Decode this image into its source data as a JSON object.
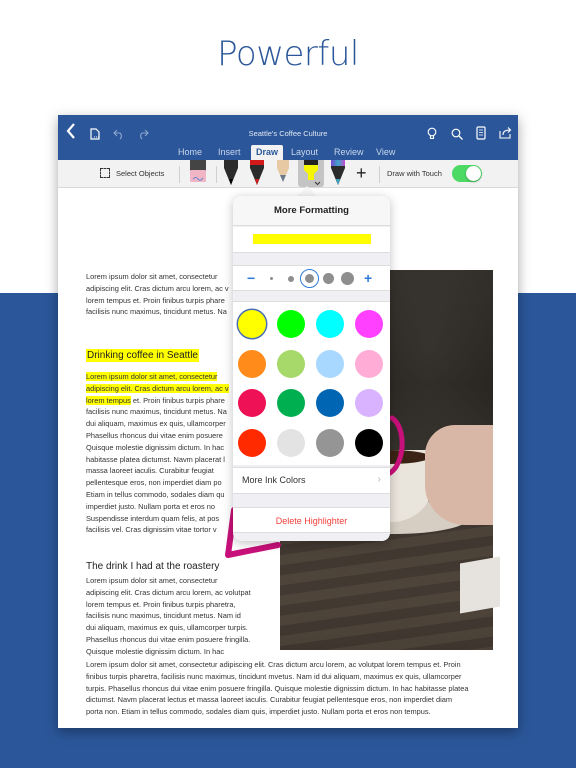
{
  "hero": {
    "title": "Powerful"
  },
  "app": {
    "doc_title": "Seattle's Coffee Culture",
    "tabs": [
      {
        "label": "Home",
        "active": false
      },
      {
        "label": "Insert",
        "active": false
      },
      {
        "label": "Draw",
        "active": true
      },
      {
        "label": "Layout",
        "active": false
      },
      {
        "label": "Review",
        "active": false
      },
      {
        "label": "View",
        "active": false
      }
    ],
    "titlebar_icons_left": [
      "back-icon",
      "file-icon",
      "undo-icon",
      "redo-icon"
    ],
    "titlebar_icons_right": [
      "lightbulb-icon",
      "search-icon",
      "device-view-icon",
      "share-icon"
    ]
  },
  "ribbon": {
    "select_objects_label": "Select Objects",
    "tools": [
      "eraser",
      "black-pen",
      "red-pen",
      "pencil",
      "yellow-highlighter",
      "galaxy-pen"
    ],
    "selected_tool": "yellow-highlighter",
    "add_label": "+",
    "draw_with_touch_label": "Draw with Touch",
    "draw_with_touch_on": true,
    "toggle_color": "#4cd964"
  },
  "document": {
    "intro_lines": [
      "Lorem ipsum dolor sit amet, consectetur",
      "adipiscing elit. Cras dictum arcu lorem, ac v",
      "lorem tempus et. Proin finibus turpis phare",
      "facilisis nunc maximus, tincidunt metus. Na"
    ],
    "heading1": "Drinking coffee in Seattle",
    "section1_highlighted": [
      "Lorem ipsum dolor sit amet, consectetur",
      "adipiscing elit. Cras dictum arcu lorem, ac v",
      "lorem tempus"
    ],
    "section1_line3_rest": " et. Proin finibus turpis phare",
    "section1_lines": [
      "facilisis nunc maximus, tincidunt metus. Na",
      "dui aliquam, maximus ex quis, ullamcorper",
      "Phasellus rhoncus dui vitae enim posuere",
      "Quisque molestie dignissim dictum. In hac",
      "habitasse platea dictumst. Navm placerat l",
      "massa laoreet iaculis. Curabitur feugiat",
      "pellentesque eros, non imperdiet diam po",
      "Etiam in tellus commodo, sodales diam qu",
      "imperdiet justo. Nullam porta et eros no",
      "Suspendisse interdum quam felis, at pos",
      "facilisis vel. Cras dignissim vitae tortor v"
    ],
    "heading2": "The drink I had at the roastery",
    "section2_lines": [
      "Lorem ipsum dolor sit amet, consectetur",
      "adipiscing elit. Cras dictum arcu lorem, ac volutpat",
      "lorem tempus et. Proin finibus turpis pharetra,",
      "facilisis nunc maximus, tincidunt metus. Nam id",
      "dui aliquam, maximus ex quis, ullamcorper turpis.",
      "Phasellus rhoncus dui vitae enim posuere fringilla.",
      "Quisque molestie dignissim dictum. In hac"
    ],
    "full_width_lines": [
      "Lorem ipsum dolor sit amet, consectetur adipiscing elit. Cras dictum arcu lorem, ac volutpat lorem tempus et. Proin",
      "finibus turpis pharetra, facilisis nunc maximus, tincidunt mvetus. Nam id dui aliquam, maximus ex quis, ullamcorper",
      "turpis. Phasellus rhoncus dui vitae enim posuere fringilla. Quisque molestie dignissim dictum. In hac habitasse platea",
      "dictumst. Navm placerat lectus et massa laoreet iaculis. Curabitur feugiat pellentesque eros, non imperdiet diam",
      "porta non. Etiam in tellus commodo, sodales diam quis, imperdiet justo. Nullam porta et eros non tempus."
    ],
    "highlight_color": "#ffff00",
    "ink_color": "#c8107a"
  },
  "popover": {
    "title": "More Formatting",
    "preview_color": "#ffff00",
    "decrease_label": "−",
    "increase_label": "+",
    "thickness_levels": 5,
    "selected_thickness": 3,
    "colors": [
      "#ffff00",
      "#00ff00",
      "#00ffff",
      "#ff40ff",
      "#ff8c1a",
      "#a6d96a",
      "#a8d8ff",
      "#ffadd6",
      "#ee1155",
      "#00b050",
      "#0066b3",
      "#d9b3ff",
      "#ff2a00",
      "#e3e3e3",
      "#959595",
      "#000000"
    ],
    "selected_color": "#ffff00",
    "more_ink_colors_label": "More Ink Colors",
    "more_chevron": "›",
    "delete_label": "Delete Highlighter"
  }
}
